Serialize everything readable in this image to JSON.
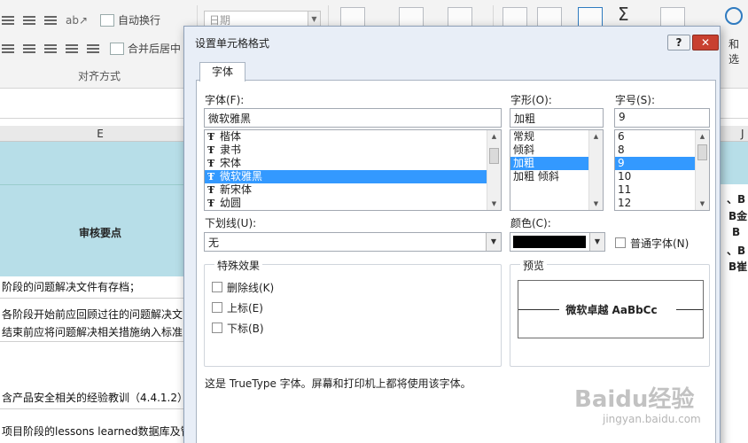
{
  "ribbon": {
    "wrap_text": "自动换行",
    "merge_center": "合并后居中",
    "group_alignment": "对齐方式",
    "number_format": "日期",
    "right_label": "和选"
  },
  "sheet": {
    "col_e": "E",
    "col_j": "J",
    "header_cell": "审核要点",
    "rows": [
      "阶段的问题解决文件有存档；",
      "各阶段开始前应回顾过往的问题解决文",
      "结束前应将问题解决相关措施纳入标准；",
      "含产品安全相关的经验教训（4.4.1.2）",
      "项目阶段的lessons learned数据库及管理"
    ],
    "right_cells": [
      "、B",
      "B金",
      "B",
      "、B",
      "B崔"
    ]
  },
  "dialog": {
    "title": "设置单元格格式",
    "help_label": "?",
    "close_label": "✕",
    "tab_font": "字体",
    "font_label": "字体(F):",
    "font_value": "微软雅黑",
    "font_list": [
      "楷体",
      "隶书",
      "宋体",
      "微软雅黑",
      "新宋体",
      "幼圆"
    ],
    "font_list_selected": 3,
    "style_label": "字形(O):",
    "style_value": "加粗",
    "style_list": [
      "常规",
      "倾斜",
      "加粗",
      "加粗 倾斜"
    ],
    "style_list_selected": 2,
    "size_label": "字号(S):",
    "size_value": "9",
    "size_list": [
      "6",
      "8",
      "9",
      "10",
      "11",
      "12"
    ],
    "size_list_selected": 2,
    "underline_label": "下划线(U):",
    "underline_value": "无",
    "color_label": "颜色(C):",
    "color_value": "#000000",
    "normal_font_label": "普通字体(N)",
    "effects_title": "特殊效果",
    "strikethrough_label": "删除线(K)",
    "superscript_label": "上标(E)",
    "subscript_label": "下标(B)",
    "preview_title": "预览",
    "preview_text": "微软卓越  AaBbCc",
    "description": "这是 TrueType 字体。屏幕和打印机上都将使用该字体。"
  },
  "watermark": {
    "brand": "Baidu经验",
    "url": "jingyan.baidu.com"
  }
}
